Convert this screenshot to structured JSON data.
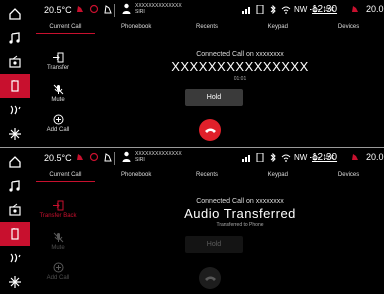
{
  "status_bar": {
    "temp_left": "20.5°C",
    "user_text_line1": "XXXXXXXXXXXXXX",
    "user_text_line2": "SIRI",
    "compass": "NW",
    "outside_temp": "15°C",
    "clock": "12:30",
    "temp_right": "20.0°C"
  },
  "sidebar": {
    "items": [
      {
        "icon": "home-icon"
      },
      {
        "icon": "music-icon"
      },
      {
        "icon": "radio-icon"
      },
      {
        "icon": "phone-icon",
        "active": true
      },
      {
        "icon": "climate-icon"
      },
      {
        "icon": "apps-icon"
      }
    ]
  },
  "tabs": [
    "Current Call",
    "Phonebook",
    "Recents",
    "Keypad",
    "Devices"
  ],
  "screen1": {
    "actions": {
      "transfer": "Transfer",
      "mute": "Mute",
      "add_call": "Add Call"
    },
    "connected_label": "Connected Call on xxxxxxxx",
    "caller": "XXXXXXXXXXXXXXX",
    "timer": "01:01",
    "hold": "Hold"
  },
  "screen2": {
    "actions": {
      "transfer": "Transfer Back",
      "mute": "Mute",
      "add_call": "Add Call"
    },
    "connected_label": "Connected Call on xxxxxxxx",
    "title": "Audio Transferred",
    "subtitle": "Transferred to Phone",
    "hold": "Hold"
  },
  "colors": {
    "accent": "#c8102e",
    "end_call": "#e0202a",
    "background": "#000000"
  }
}
